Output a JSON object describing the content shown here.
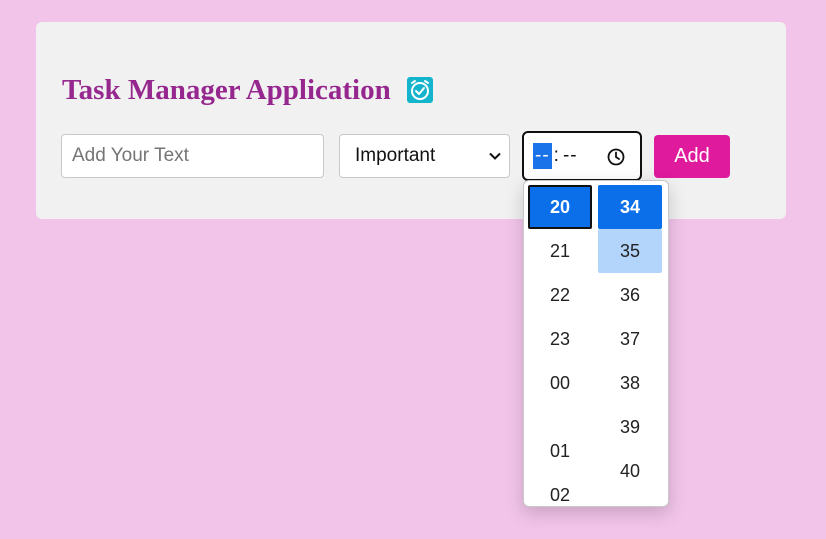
{
  "app": {
    "title": "Task Manager Application",
    "icon": "alarm-clock-check-icon"
  },
  "form": {
    "text_input": {
      "placeholder": "Add Your Text",
      "value": ""
    },
    "priority_select": {
      "selected": "Important"
    },
    "time_input": {
      "hour": "--",
      "separator": ":",
      "minute": "--",
      "icon": "clock-icon"
    },
    "add_label": "Add"
  },
  "time_picker": {
    "hours": [
      "20",
      "21",
      "22",
      "23",
      "00",
      "01",
      "02"
    ],
    "minutes": [
      "34",
      "35",
      "36",
      "37",
      "38",
      "39",
      "40"
    ],
    "selected_hour": "20",
    "selected_minute": "34",
    "hovered_minute": "35"
  },
  "colors": {
    "background": "#f2c4ea",
    "title": "#96278e",
    "button": "#e01a9d",
    "selection": "#0a6fe8",
    "hover": "#b3d4fb",
    "icon_bg": "#14b5cc"
  }
}
